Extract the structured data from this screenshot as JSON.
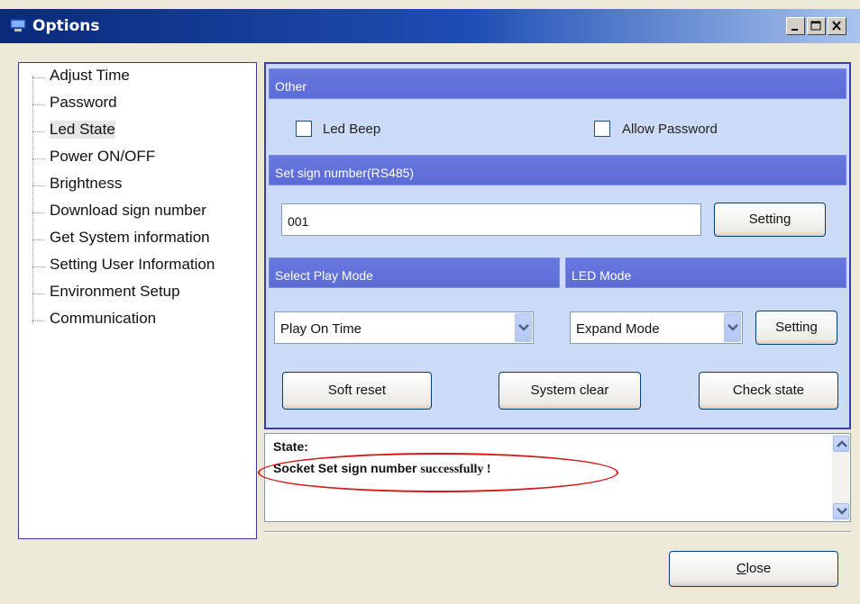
{
  "window": {
    "title": "Options"
  },
  "tree": {
    "items": [
      {
        "label": "Adjust Time",
        "selected": false
      },
      {
        "label": "Password",
        "selected": false
      },
      {
        "label": "Led State",
        "selected": true
      },
      {
        "label": "Power ON/OFF",
        "selected": false
      },
      {
        "label": "Brightness",
        "selected": false
      },
      {
        "label": "Download sign number",
        "selected": false
      },
      {
        "label": "Get System information",
        "selected": false
      },
      {
        "label": "Setting User Information",
        "selected": false
      },
      {
        "label": "Environment Setup",
        "selected": false
      },
      {
        "label": "Communication",
        "selected": false
      }
    ]
  },
  "other": {
    "header": "Other",
    "led_beep": {
      "label": "Led Beep",
      "checked": false
    },
    "allow_password": {
      "label": "Allow Password",
      "checked": false
    }
  },
  "sign_number": {
    "header": "Set sign number(RS485)",
    "value": "001",
    "button": "Setting"
  },
  "play_mode": {
    "header": "Select Play  Mode",
    "selected": "Play On Time"
  },
  "led_mode": {
    "header": "LED Mode",
    "selected": "Expand Mode",
    "button": "Setting"
  },
  "actions": {
    "soft_reset": "Soft reset",
    "system_clear": "System clear",
    "check_state": "Check state"
  },
  "state": {
    "title": "State:",
    "message_bold": "Socket Set sign number",
    "message_tail": "successfully !"
  },
  "footer": {
    "close": "Close"
  },
  "colors": {
    "annotation": "#d21a1a",
    "header": "#5b6cd6",
    "panel": "#ccdcf7"
  }
}
